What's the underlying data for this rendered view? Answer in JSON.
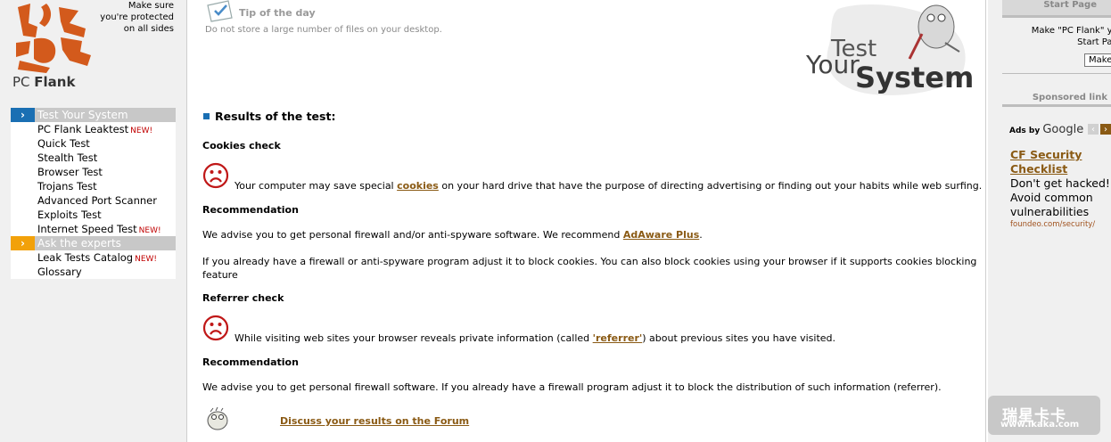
{
  "brand": {
    "logo_text_pc": "PC ",
    "logo_text_flank": "Flank",
    "tagline": [
      "Make sure",
      "you're protected",
      "on all sides"
    ]
  },
  "nav": {
    "section1": {
      "label": "Test Your System",
      "items": [
        {
          "label": "PC Flank Leaktest",
          "new": "NEW!"
        },
        {
          "label": "Quick Test",
          "new": ""
        },
        {
          "label": "Stealth Test",
          "new": ""
        },
        {
          "label": "Browser Test",
          "new": ""
        },
        {
          "label": "Trojans Test",
          "new": ""
        },
        {
          "label": "Advanced Port Scanner",
          "new": ""
        },
        {
          "label": "Exploits Test",
          "new": ""
        },
        {
          "label": "Internet Speed Test",
          "new": "NEW!"
        }
      ]
    },
    "section2": {
      "label": "Ask the experts",
      "items": [
        {
          "label": "Leak Tests Catalog",
          "new": "NEW!"
        },
        {
          "label": "Glossary",
          "new": ""
        }
      ]
    }
  },
  "tip": {
    "title": "Tip of the day",
    "text": "Do not store a large number of files on your desktop."
  },
  "banner": {
    "line1": "Test",
    "line2": "Your",
    "line3": "System"
  },
  "results": {
    "heading": "Results of the test:",
    "cookies": {
      "title": "Cookies check",
      "msg_before": "Your computer may save special ",
      "msg_link": "cookies",
      "msg_after": " on your hard drive that have the purpose of directing advertising or finding out your habits while web surfing.",
      "rec_title": "Recommendation",
      "rec1_before": "We advise you to get personal firewall and/or anti-spyware software. We recommend ",
      "rec1_link": "AdAware Plus",
      "rec1_after": ".",
      "rec2": "If you already have a firewall or anti-spyware program adjust it to block cookies. You can also block cookies using your browser if it supports cookies blocking feature"
    },
    "referrer": {
      "title": "Referrer check",
      "msg_before": "While visiting web sites your browser reveals private information (called ",
      "msg_link": "'referrer'",
      "msg_after": ") about previous sites you have visited.",
      "rec_title": "Recommendation",
      "rec1": "We advise you to get personal firewall software. If you already have a firewall program adjust it to block the distribution of such information (referrer)."
    },
    "forum_link": "Discuss your results on the Forum"
  },
  "right": {
    "start_page_head": "Start Page",
    "start_page_text": [
      "Make \"PC Flank\" you",
      "Start Page"
    ],
    "make_button": "Make",
    "sponsored_head": "Sponsored link",
    "ads_by": "Ads by ",
    "google": "Google",
    "ad_title": "CF Security Checklist",
    "ad_body": "Don't get hacked! Avoid common vulnerabilities",
    "ad_url": "foundeo.com/security/"
  },
  "watermark": {
    "line1": "瑞星卡卡",
    "line2": "www.ikaka.com"
  },
  "colors": {
    "accent_blue": "#1a6fb3",
    "accent_orange": "#f2a10a",
    "link_brown": "#8a5a14",
    "new_red": "#c00000"
  }
}
